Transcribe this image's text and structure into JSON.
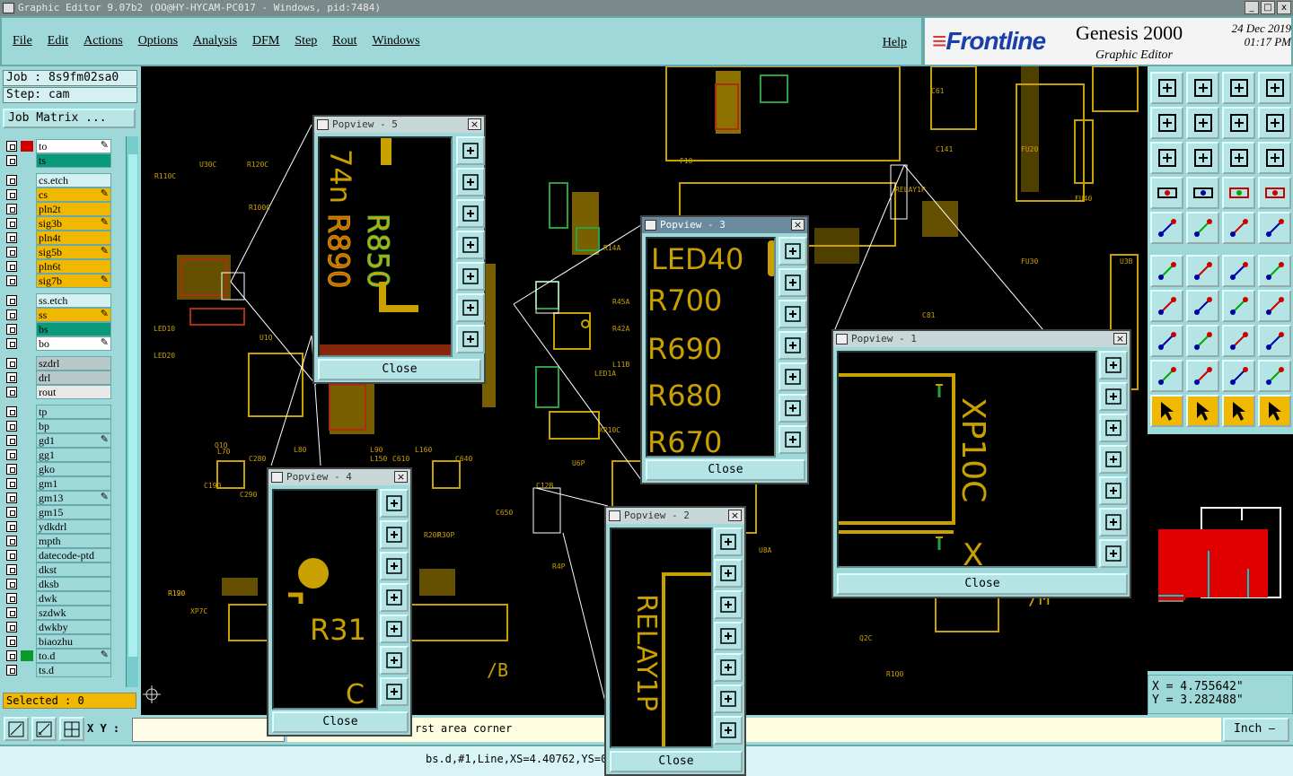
{
  "window": {
    "title": "Graphic Editor 9.07b2 (OO@HY-HYCAM-PC017 - Windows, pid:7484)",
    "min": "_",
    "max": "□",
    "close": "x"
  },
  "menu": {
    "items": [
      "File",
      "Edit",
      "Actions",
      "Options",
      "Analysis",
      "DFM",
      "Step",
      "Rout",
      "Windows"
    ],
    "help": "Help"
  },
  "brand": {
    "logo": "Frontline",
    "product": "Genesis 2000",
    "subtitle": "Graphic Editor",
    "date": "24 Dec 2019",
    "time": "01:17 PM"
  },
  "job": {
    "job": "Job : 8s9fm02sa0",
    "step": "Step: cam",
    "matrix": "Job Matrix ..."
  },
  "layers": [
    {
      "name": "to",
      "color": "#ffffff",
      "swatch": "#d00000",
      "mark": "✎"
    },
    {
      "name": "ts",
      "color": "#0a9a7a"
    },
    {
      "name": "cs.etch",
      "color": "#d4f0f0"
    },
    {
      "name": "cs",
      "color": "#f0b800",
      "mark": "✎"
    },
    {
      "name": "pln2t",
      "color": "#f0b800"
    },
    {
      "name": "sig3b",
      "color": "#f0b800",
      "mark": "✎"
    },
    {
      "name": "pln4t",
      "color": "#f0b800"
    },
    {
      "name": "sig5b",
      "color": "#f0b800",
      "mark": "✎"
    },
    {
      "name": "pln6t",
      "color": "#f0b800"
    },
    {
      "name": "sig7b",
      "color": "#f0b800",
      "mark": "✎"
    },
    {
      "name": "ss.etch",
      "color": "#d4f0f0"
    },
    {
      "name": "ss",
      "color": "#f0b800",
      "mark": "✎"
    },
    {
      "name": "bs",
      "color": "#0a9a7a"
    },
    {
      "name": "bo",
      "color": "#ffffff",
      "mark": "✎"
    },
    {
      "name": "szdrl",
      "color": "#b8c8c8"
    },
    {
      "name": "drl",
      "color": "#b8c8c8"
    },
    {
      "name": "rout",
      "color": "#e8e8e8"
    },
    {
      "name": "tp",
      "color": "#9fd8d8"
    },
    {
      "name": "bp",
      "color": "#9fd8d8"
    },
    {
      "name": "gd1",
      "color": "#9fd8d8",
      "mark": "✎"
    },
    {
      "name": "gg1",
      "color": "#9fd8d8"
    },
    {
      "name": "gko",
      "color": "#9fd8d8"
    },
    {
      "name": "gm1",
      "color": "#9fd8d8"
    },
    {
      "name": "gm13",
      "color": "#9fd8d8",
      "mark": "✎"
    },
    {
      "name": "gm15",
      "color": "#9fd8d8"
    },
    {
      "name": "ydkdrl",
      "color": "#9fd8d8"
    },
    {
      "name": "mpth",
      "color": "#9fd8d8"
    },
    {
      "name": "datecode-ptd",
      "color": "#9fd8d8"
    },
    {
      "name": "dkst",
      "color": "#9fd8d8"
    },
    {
      "name": "dksb",
      "color": "#9fd8d8"
    },
    {
      "name": "dwk",
      "color": "#9fd8d8"
    },
    {
      "name": "szdwk",
      "color": "#9fd8d8"
    },
    {
      "name": "dwkby",
      "color": "#9fd8d8"
    },
    {
      "name": "biaozhu",
      "color": "#9fd8d8"
    },
    {
      "name": "to.d",
      "color": "#9fd8d8",
      "swatch": "#0a9a2a",
      "mark": "✎"
    },
    {
      "name": "ts.d",
      "color": "#9fd8d8"
    }
  ],
  "selected": "Selected : 0",
  "coords": {
    "x": "X = 4.755642\"",
    "y": "Y = 3.282488\""
  },
  "bottom": {
    "xy_label": "X Y :",
    "prompt": "rst area corner",
    "unit": "Inch ⎯"
  },
  "status": "bs.d,#1,Line,XS=4.40762,YS=0                                   33565,r10,POS,Ang=0",
  "popviews": [
    {
      "title": "Popview - 5",
      "close": "Close",
      "labels": [
        "74n",
        "R850",
        "R890"
      ]
    },
    {
      "title": "Popview - 3",
      "close": "Close",
      "labels": [
        "LED40",
        "R700",
        "R690",
        "R680",
        "R670"
      ]
    },
    {
      "title": "Popview - 1",
      "close": "Close",
      "labels": [
        "XP10C",
        "X"
      ]
    },
    {
      "title": "Popview - 4",
      "close": "Close",
      "labels": [
        "R31",
        "C"
      ]
    },
    {
      "title": "Popview - 2",
      "close": "Close",
      "labels": [
        "RELAY1P"
      ]
    }
  ],
  "canvas_labels": [
    "R110C",
    "U30C",
    "R120C",
    "R100C",
    "LED10",
    "LED20",
    "R190",
    "C190",
    "L70",
    "L80",
    "L90",
    "L150",
    "L160",
    "C280",
    "C290",
    "C610",
    "C640",
    "C650",
    "U1Q",
    "Q1Q",
    "R120",
    "U6P",
    "U8A",
    "R4P",
    "R20P",
    "R30P",
    "F10",
    "C81",
    "C61",
    "C141",
    "FU20",
    "FU30",
    "FU40",
    "U3B",
    "R14A",
    "R45A",
    "R42A",
    "L11B",
    "LED1A",
    "XP10C",
    "RELAY1P",
    "C12B",
    "Q2C",
    "/M",
    "/B",
    "R1Q0",
    "XP7C"
  ]
}
